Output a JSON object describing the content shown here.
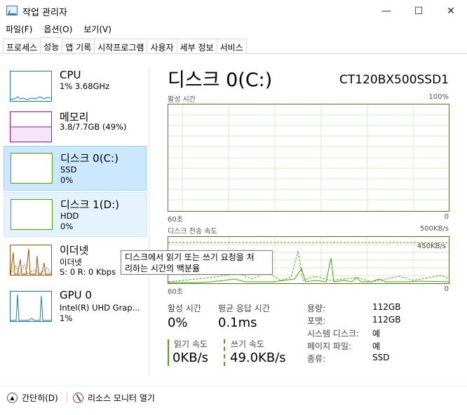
{
  "window": {
    "title": "작업 관리자",
    "minimize": "—",
    "maximize": "☐",
    "close": "✕"
  },
  "menu": [
    "파일(F)",
    "옵션(O)",
    "보기(V)"
  ],
  "tabs": [
    "프로세스",
    "성능",
    "앱 기록",
    "시작프로그램",
    "사용자",
    "세부 정보",
    "서비스"
  ],
  "sidebar": {
    "items": [
      {
        "title": "CPU",
        "line2": "1% 3.68GHz",
        "line3": ""
      },
      {
        "title": "메모리",
        "line2": "3.8/7.7GB (49%)",
        "line3": ""
      },
      {
        "title": "디스크 0(C:)",
        "line2": "SSD",
        "line3": "0%"
      },
      {
        "title": "디스크 1(D:)",
        "line2": "HDD",
        "line3": "0%"
      },
      {
        "title": "이더넷",
        "line2": "이더넷",
        "line3": "S: 0 R: 0 Kbps"
      },
      {
        "title": "GPU 0",
        "line2": "Intel(R) UHD Grap...",
        "line3": "1%"
      }
    ]
  },
  "colors": {
    "cpu": "#117dbb",
    "memory": "#8b12ae",
    "disk": "#4da60c",
    "ethernet": "#a74f01",
    "gpu": "#117dbb",
    "selected_bg": "#cce8ff"
  },
  "main": {
    "title": "디스크 0(C:)",
    "model": "CT120BX500SSD1",
    "graph1": {
      "label": "활성 시간",
      "max": "100%",
      "time": "60초",
      "min": "0"
    },
    "graph2": {
      "label": "디스크 전송 속도",
      "max": "500KB/s",
      "mid": "450KB/s",
      "time": "60초",
      "min": "0"
    },
    "stats": {
      "active_label": "활성 시간",
      "active_value": "0%",
      "response_label": "평균 응답 시간",
      "response_value": "0.1ms",
      "read_label": "읽기 속도",
      "read_value": "0KB/s",
      "write_label": "쓰기 속도",
      "write_value": "49.0KB/s"
    },
    "info": [
      {
        "label": "용량:",
        "value": "112GB"
      },
      {
        "label": "포맷:",
        "value": "112GB"
      },
      {
        "label": "시스템 디스크:",
        "value": "예"
      },
      {
        "label": "페이지 파일:",
        "value": "예"
      },
      {
        "label": "종류:",
        "value": "SSD"
      }
    ]
  },
  "tooltip": {
    "line1": "디스크에서 읽기 또는 쓰기 요청을 처",
    "line2": "리하는 시간의 백분율"
  },
  "bottom": {
    "fewer_details": "간단히(D)",
    "resource_monitor": "리소스 모니터 열기"
  }
}
